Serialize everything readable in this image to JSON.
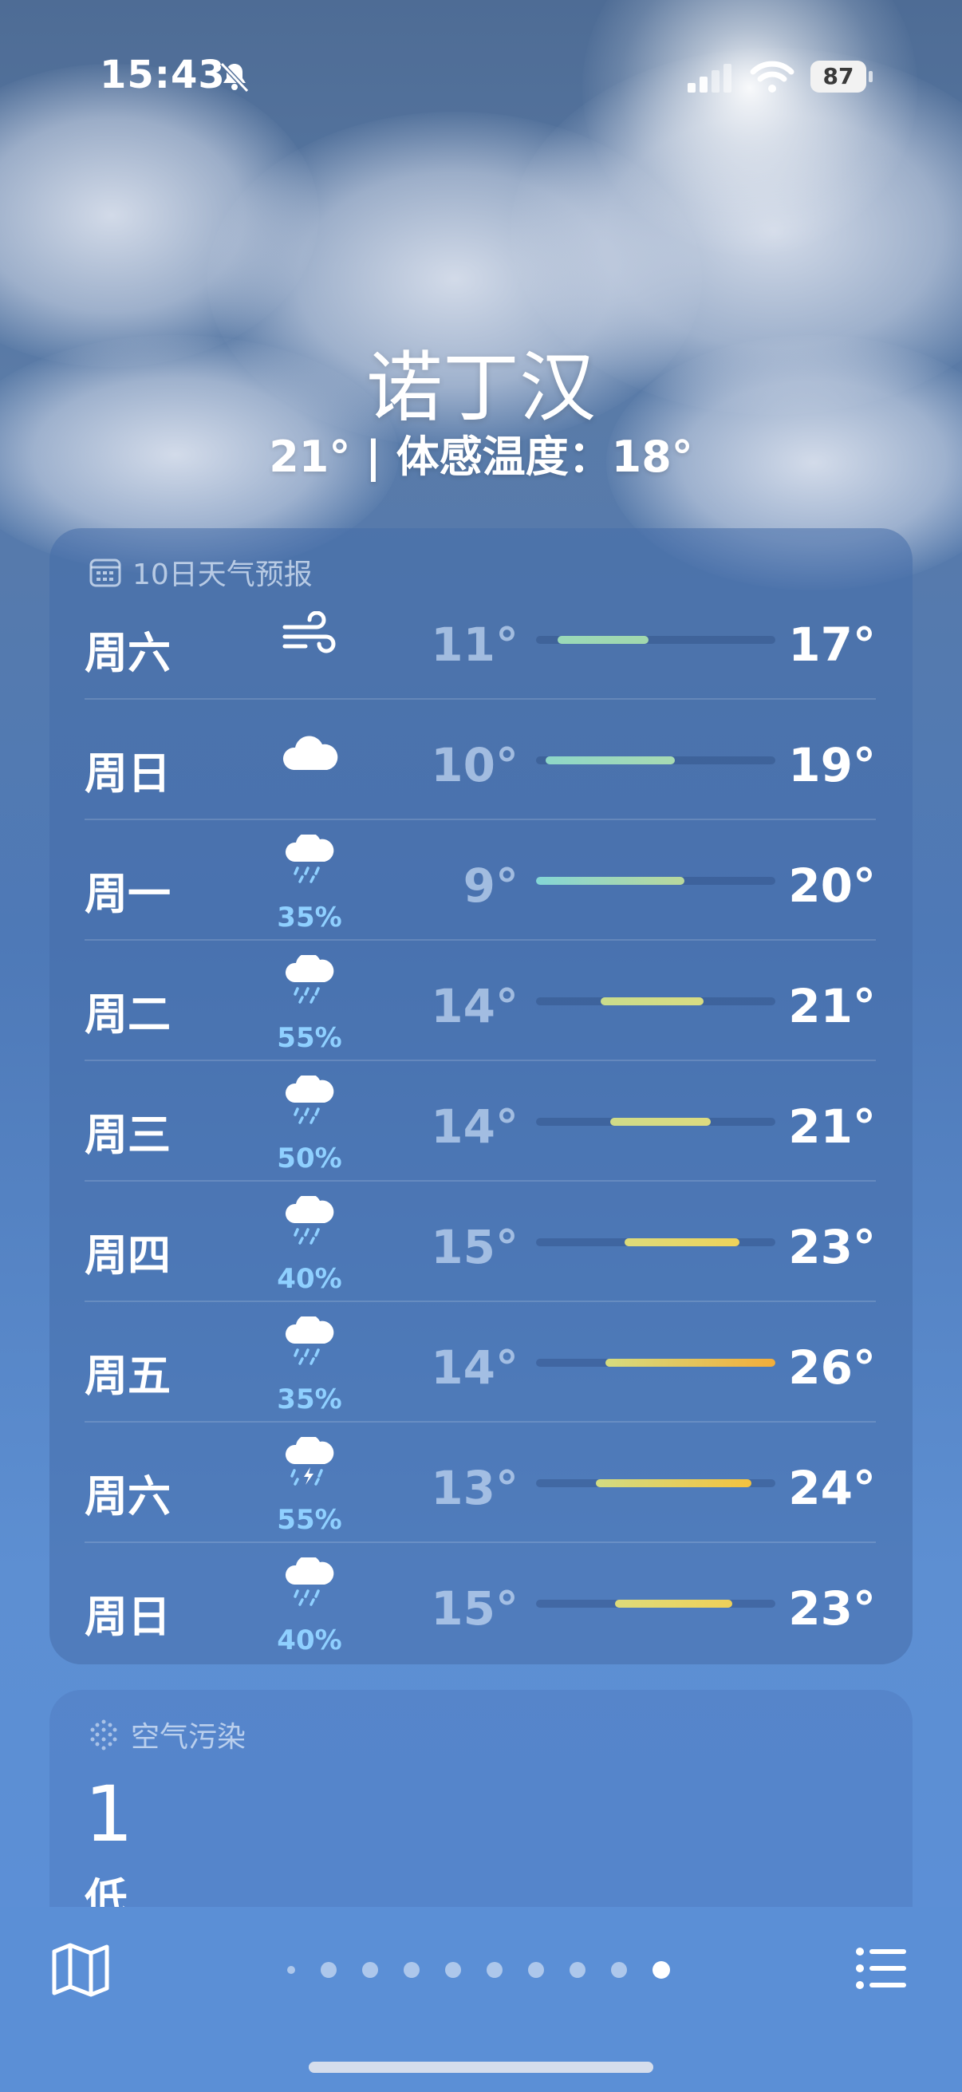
{
  "status_bar": {
    "time": "15:43",
    "battery": "87",
    "icons": [
      "bell-slash-icon",
      "cellular-signal-icon",
      "wifi-icon",
      "battery-icon"
    ]
  },
  "header": {
    "city": "诺丁汉",
    "current": "21° | 体感温度：18°"
  },
  "forecast": {
    "title": "10日天气预报",
    "icon": "calendar-icon",
    "days": [
      {
        "day": "周六",
        "icon": "wind-icon",
        "prob": "",
        "low": "11°",
        "high": "17°",
        "range_start": 0.09,
        "range_end": 0.47,
        "colors": [
          "#9ad9b8",
          "#a2d8ad"
        ]
      },
      {
        "day": "周日",
        "icon": "cloud-icon",
        "prob": "",
        "low": "10°",
        "high": "19°",
        "range_start": 0.04,
        "range_end": 0.58,
        "colors": [
          "#8ed7c8",
          "#a8dab2"
        ]
      },
      {
        "day": "周一",
        "icon": "cloud-drizzle-icon",
        "prob": "35%",
        "low": "9°",
        "high": "20°",
        "range_start": 0.0,
        "range_end": 0.62,
        "colors": [
          "#84d6d6",
          "#b9d89c"
        ]
      },
      {
        "day": "周二",
        "icon": "cloud-drizzle-icon",
        "prob": "55%",
        "low": "14°",
        "high": "21°",
        "range_start": 0.27,
        "range_end": 0.7,
        "colors": [
          "#c9dc8c",
          "#d8dc82"
        ]
      },
      {
        "day": "周三",
        "icon": "cloud-drizzle-icon",
        "prob": "50%",
        "low": "14°",
        "high": "21°",
        "range_start": 0.31,
        "range_end": 0.73,
        "colors": [
          "#cfdb88",
          "#dcdb80"
        ]
      },
      {
        "day": "周四",
        "icon": "cloud-drizzle-icon",
        "prob": "40%",
        "low": "15°",
        "high": "23°",
        "range_start": 0.37,
        "range_end": 0.85,
        "colors": [
          "#dedb7a",
          "#eed35a"
        ]
      },
      {
        "day": "周五",
        "icon": "cloud-drizzle-icon",
        "prob": "35%",
        "low": "14°",
        "high": "26°",
        "range_start": 0.29,
        "range_end": 1.0,
        "colors": [
          "#d6dc7e",
          "#f2ad3a"
        ]
      },
      {
        "day": "周六",
        "icon": "cloud-bolt-rain-icon",
        "prob": "55%",
        "low": "13°",
        "high": "24°",
        "range_start": 0.25,
        "range_end": 0.9,
        "colors": [
          "#d2dc82",
          "#f4c23e"
        ]
      },
      {
        "day": "周日",
        "icon": "cloud-drizzle-icon",
        "prob": "40%",
        "low": "15°",
        "high": "23°",
        "range_start": 0.33,
        "range_end": 0.82,
        "colors": [
          "#dedb7a",
          "#efd058"
        ]
      }
    ]
  },
  "air": {
    "title": "空气污染",
    "icon": "air-quality-icon",
    "value": "1",
    "label": "低"
  },
  "bottom": {
    "map_icon": "map-icon",
    "list_icon": "list-icon",
    "page_count": 10,
    "current_page": 10
  }
}
